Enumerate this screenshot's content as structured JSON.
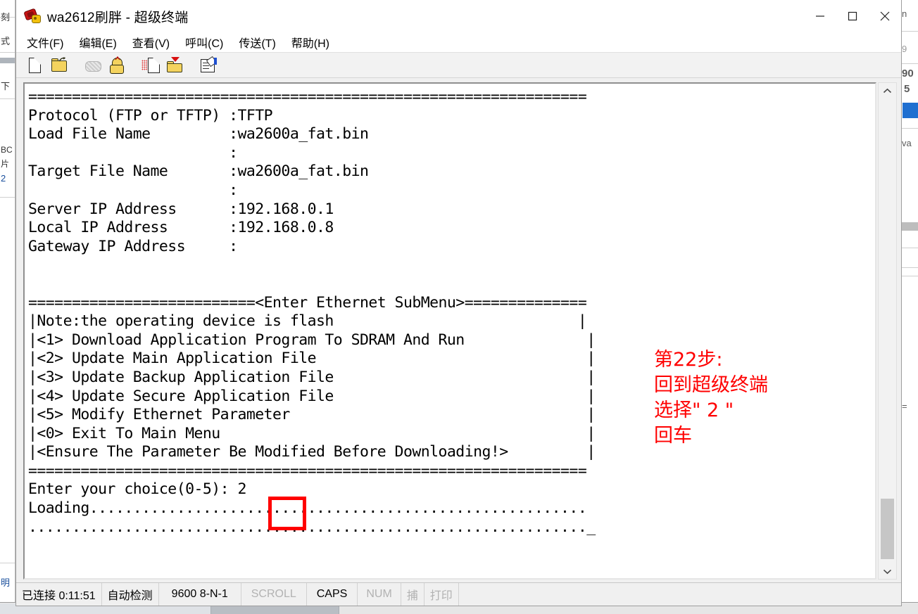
{
  "window": {
    "title": "wa2612刷胖 - 超级终端",
    "app_icon": "hyperterminal-icon",
    "controls": {
      "minimize": "minimize-button",
      "maximize": "maximize-button",
      "close": "close-button"
    }
  },
  "menubar": {
    "items": [
      {
        "label": "文件(F)",
        "name": "menu-file"
      },
      {
        "label": "编辑(E)",
        "name": "menu-edit"
      },
      {
        "label": "查看(V)",
        "name": "menu-view"
      },
      {
        "label": "呼叫(C)",
        "name": "menu-call"
      },
      {
        "label": "传送(T)",
        "name": "menu-transfer"
      },
      {
        "label": "帮助(H)",
        "name": "menu-help"
      }
    ]
  },
  "toolbar": {
    "buttons": [
      {
        "name": "new-connection-icon",
        "title": "新建"
      },
      {
        "name": "open-folder-icon",
        "title": "打开"
      },
      {
        "name": "disconnect-phone-icon",
        "title": "断开",
        "disabled": true
      },
      {
        "name": "call-phone-icon",
        "title": "呼叫"
      },
      {
        "name": "send-file-icon",
        "title": "发送"
      },
      {
        "name": "receive-file-icon",
        "title": "接收"
      },
      {
        "name": "properties-icon",
        "title": "属性"
      }
    ]
  },
  "terminal": {
    "lines": [
      "================================================================",
      "Protocol (FTP or TFTP) :TFTP",
      "Load File Name         :wa2600a_fat.bin",
      "                       :",
      "Target File Name       :wa2600a_fat.bin",
      "                       :",
      "Server IP Address      :192.168.0.1",
      "Local IP Address       :192.168.0.8",
      "Gateway IP Address     :",
      "",
      "",
      "==========================<Enter Ethernet SubMenu>==============",
      "|Note:the operating device is flash                            |",
      "|<1> Download Application Program To SDRAM And Run             |",
      "|<2> Update Main Application File                              |",
      "|<3> Update Backup Application File                            |",
      "|<4> Update Secure Application File                            |",
      "|<5> Modify Ethernet Parameter                                 |",
      "|<0> Exit To Main Menu                                         |",
      "|<Ensure The Parameter Be Modified Before Downloading!>        |",
      "================================================================",
      "Enter your choice(0-5): 2",
      "Loading..........................................................",
      "..............................................................._"
    ],
    "text": "================================================================\nProtocol (FTP or TFTP) :TFTP\nLoad File Name         :wa2600a_fat.bin\n                       :\nTarget File Name       :wa2600a_fat.bin\n                       :\nServer IP Address      :192.168.0.1\nLocal IP Address       :192.168.0.8\nGateway IP Address     :\n\n\n==========================<Enter Ethernet SubMenu>==============\n|Note:the operating device is flash                            |\n|<1> Download Application Program To SDRAM And Run              |\n|<2> Update Main Application File                               |\n|<3> Update Backup Application File                             |\n|<4> Update Secure Application File                             |\n|<5> Modify Ethernet Parameter                                  |\n|<0> Exit To Main Menu                                          |\n|<Ensure The Parameter Be Modified Before Downloading!>         |\n================================================================\nEnter your choice(0-5): 2\nLoading.........................................................\n................................................................_",
    "user_choice": "2",
    "menu_options": [
      {
        "key": "1",
        "label": "Download Application Program To SDRAM And Run"
      },
      {
        "key": "2",
        "label": "Update Main Application File"
      },
      {
        "key": "3",
        "label": "Update Backup Application File"
      },
      {
        "key": "4",
        "label": "Update Secure Application File"
      },
      {
        "key": "5",
        "label": "Modify Ethernet Parameter"
      },
      {
        "key": "0",
        "label": "Exit To Main Menu"
      }
    ],
    "params": {
      "protocol": "TFTP",
      "load_file_name": "wa2600a_fat.bin",
      "target_file_name": "wa2600a_fat.bin",
      "server_ip": "192.168.0.1",
      "local_ip": "192.168.0.8",
      "gateway_ip": ""
    }
  },
  "annotation": {
    "text": "第22步:\n回到超级终端\n选择\" 2 \"\n回车",
    "color": "#ff0000"
  },
  "scrollbar": {
    "up_arrow": "chevron-up-icon",
    "down_arrow": "chevron-down-icon"
  },
  "statusbar": {
    "cells": [
      {
        "label": "已连接 0:11:51",
        "name": "status-connected",
        "dim": false
      },
      {
        "label": "自动检测",
        "name": "status-autodetect",
        "dim": false
      },
      {
        "label": "9600 8-N-1",
        "name": "status-serial-settings",
        "dim": false
      },
      {
        "label": "SCROLL",
        "name": "status-scroll-lock",
        "dim": true
      },
      {
        "label": "CAPS",
        "name": "status-caps-lock",
        "dim": false
      },
      {
        "label": "NUM",
        "name": "status-num-lock",
        "dim": true
      },
      {
        "label": "捕",
        "name": "status-capture",
        "dim": true
      },
      {
        "label": "打印",
        "name": "status-print",
        "dim": true
      }
    ]
  },
  "background_windows": {
    "left_fragments": [
      "刻",
      "式",
      "下",
      "BC",
      "片",
      "2",
      "明"
    ],
    "right_fragments": [
      "n",
      "9",
      "90",
      "5",
      "va"
    ]
  }
}
